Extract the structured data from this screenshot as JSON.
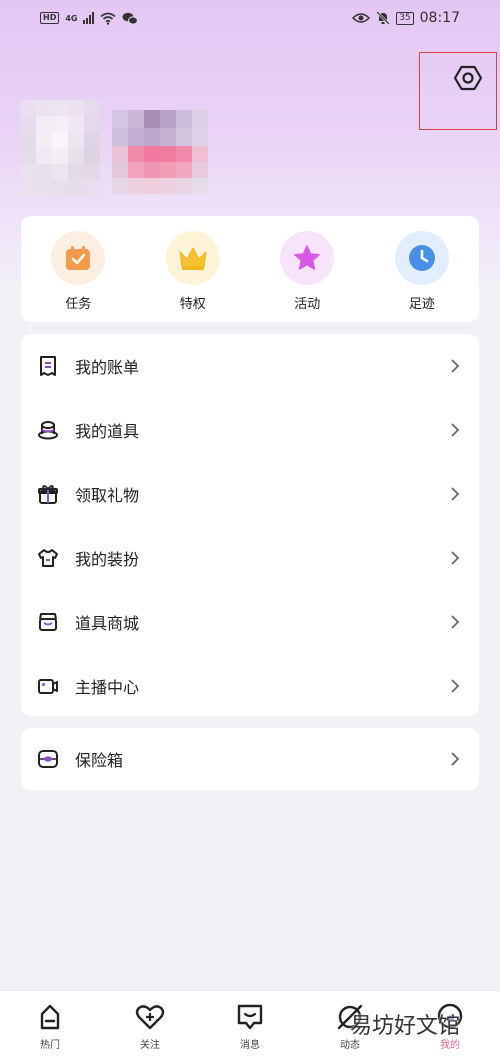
{
  "status_bar": {
    "hd": "HD",
    "network": "4G",
    "battery": "35",
    "time": "08:17"
  },
  "colors": {
    "header_gradient_top": "#e4c6f4",
    "page_background": "#f2f2f6",
    "active_tab": "#e0608a",
    "highlight_box": "#e04040"
  },
  "header": {
    "settings_icon": "settings-hexagon-icon"
  },
  "quick_actions": [
    {
      "label": "任务",
      "icon": "task-calendar-icon",
      "color": "#f59a4a",
      "bg": "#fdeee2"
    },
    {
      "label": "特权",
      "icon": "crown-icon",
      "color": "#f7c12f",
      "bg": "#fdf3d6"
    },
    {
      "label": "活动",
      "icon": "star-icon",
      "color": "#d65ae6",
      "bg": "#f8e4fa"
    },
    {
      "label": "足迹",
      "icon": "clock-icon",
      "color": "#4a8fe6",
      "bg": "#e3eefc"
    }
  ],
  "menu": [
    {
      "label": "我的账单",
      "icon": "bill-icon"
    },
    {
      "label": "我的道具",
      "icon": "hat-icon"
    },
    {
      "label": "领取礼物",
      "icon": "gift-icon"
    },
    {
      "label": "我的装扮",
      "icon": "tshirt-icon"
    },
    {
      "label": "道具商城",
      "icon": "store-icon"
    },
    {
      "label": "主播中心",
      "icon": "camera-icon"
    }
  ],
  "menu2": [
    {
      "label": "保险箱",
      "icon": "safe-box-icon"
    }
  ],
  "bottom_nav": [
    {
      "label": "热门",
      "icon": "hot-icon"
    },
    {
      "label": "关注",
      "icon": "heart-plus-icon"
    },
    {
      "label": "消息",
      "icon": "message-icon"
    },
    {
      "label": "动态",
      "icon": "planet-icon"
    },
    {
      "label": "我的",
      "icon": "profile-icon"
    }
  ],
  "watermark": "易坊好文馆"
}
